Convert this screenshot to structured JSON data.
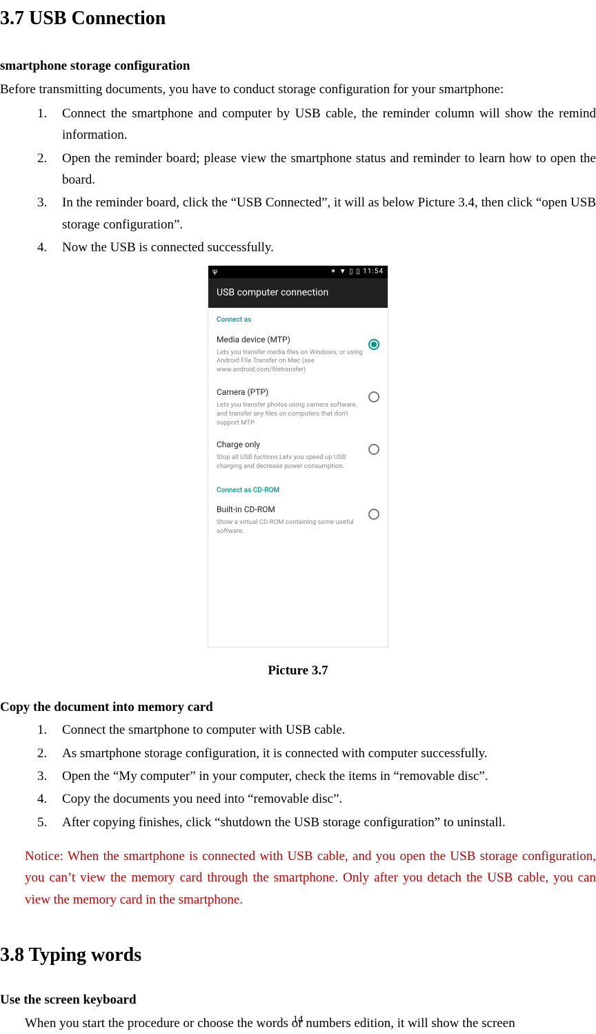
{
  "h_37": "3.7 USB Connection",
  "sub1": "smartphone storage configuration",
  "intro1": "Before transmitting documents, you have to conduct storage configuration for your smartphone:",
  "list1": {
    "n1": "1.",
    "t1": "Connect the smartphone and computer by USB cable, the reminder column will show the remind information.",
    "n2": "2.",
    "t2": "Open the reminder board; please view the smartphone status and reminder to learn how to open the board.",
    "n3": "3.",
    "t3": "In the reminder board, click the “USB Connected”, it will as below Picture 3.4, then click “open USB storage configuration”.",
    "n4": "4.",
    "t4": "Now the USB is connected successfully."
  },
  "caption": "Picture 3.7",
  "sub2": "Copy the document into memory card",
  "list2": {
    "n1": "1.",
    "t1": "Connect the smartphone to computer with USB cable.",
    "n2": "2.",
    "t2": "As smartphone storage configuration, it is connected with computer successfully.",
    "n3": "3.",
    "t3": "Open the “My computer” in your computer, check the items in “removable disc”.",
    "n4": "4.",
    "t4": "Copy the documents you need into “removable disc”.",
    "n5": "5.",
    "t5": "After copying finishes, click “shutdown the USB storage configuration” to uninstall."
  },
  "notice": "Notice: When the smartphone is connected with USB cable, and you open the USB storage configuration, you can’t view the memory card through the smartphone. Only after you detach the USB cable, you can view the memory card in the smartphone.",
  "h_38": "3.8 Typing words",
  "sub3": "Use the screen keyboard",
  "intro3": "When you start the procedure or choose the words or numbers edition, it will show the screen",
  "page_number": "14",
  "phone": {
    "status_left": "ψ",
    "status_right": "✶ ▼ ▯ ▯ 11:54",
    "appbar": "USB computer connection",
    "sec1": "Connect as",
    "opt1_title": "Media device (MTP)",
    "opt1_desc": "Lets you transfer media files on Windows, or using Android File Transfer on Mac (see www.android.com/filetransfer)",
    "opt2_title": "Camera (PTP)",
    "opt2_desc": "Lets you transfer photos using camera software, and transfer any files on computers that don't support MTP",
    "opt3_title": "Charge only",
    "opt3_desc": "Stop all USB fuctions.Lets you speed up USB charging and decrease power consumption.",
    "sec2": "Connect as CD-ROM",
    "opt4_title": "Built-in CD-ROM",
    "opt4_desc": "Show a virtual CD-ROM containing some useful software."
  }
}
